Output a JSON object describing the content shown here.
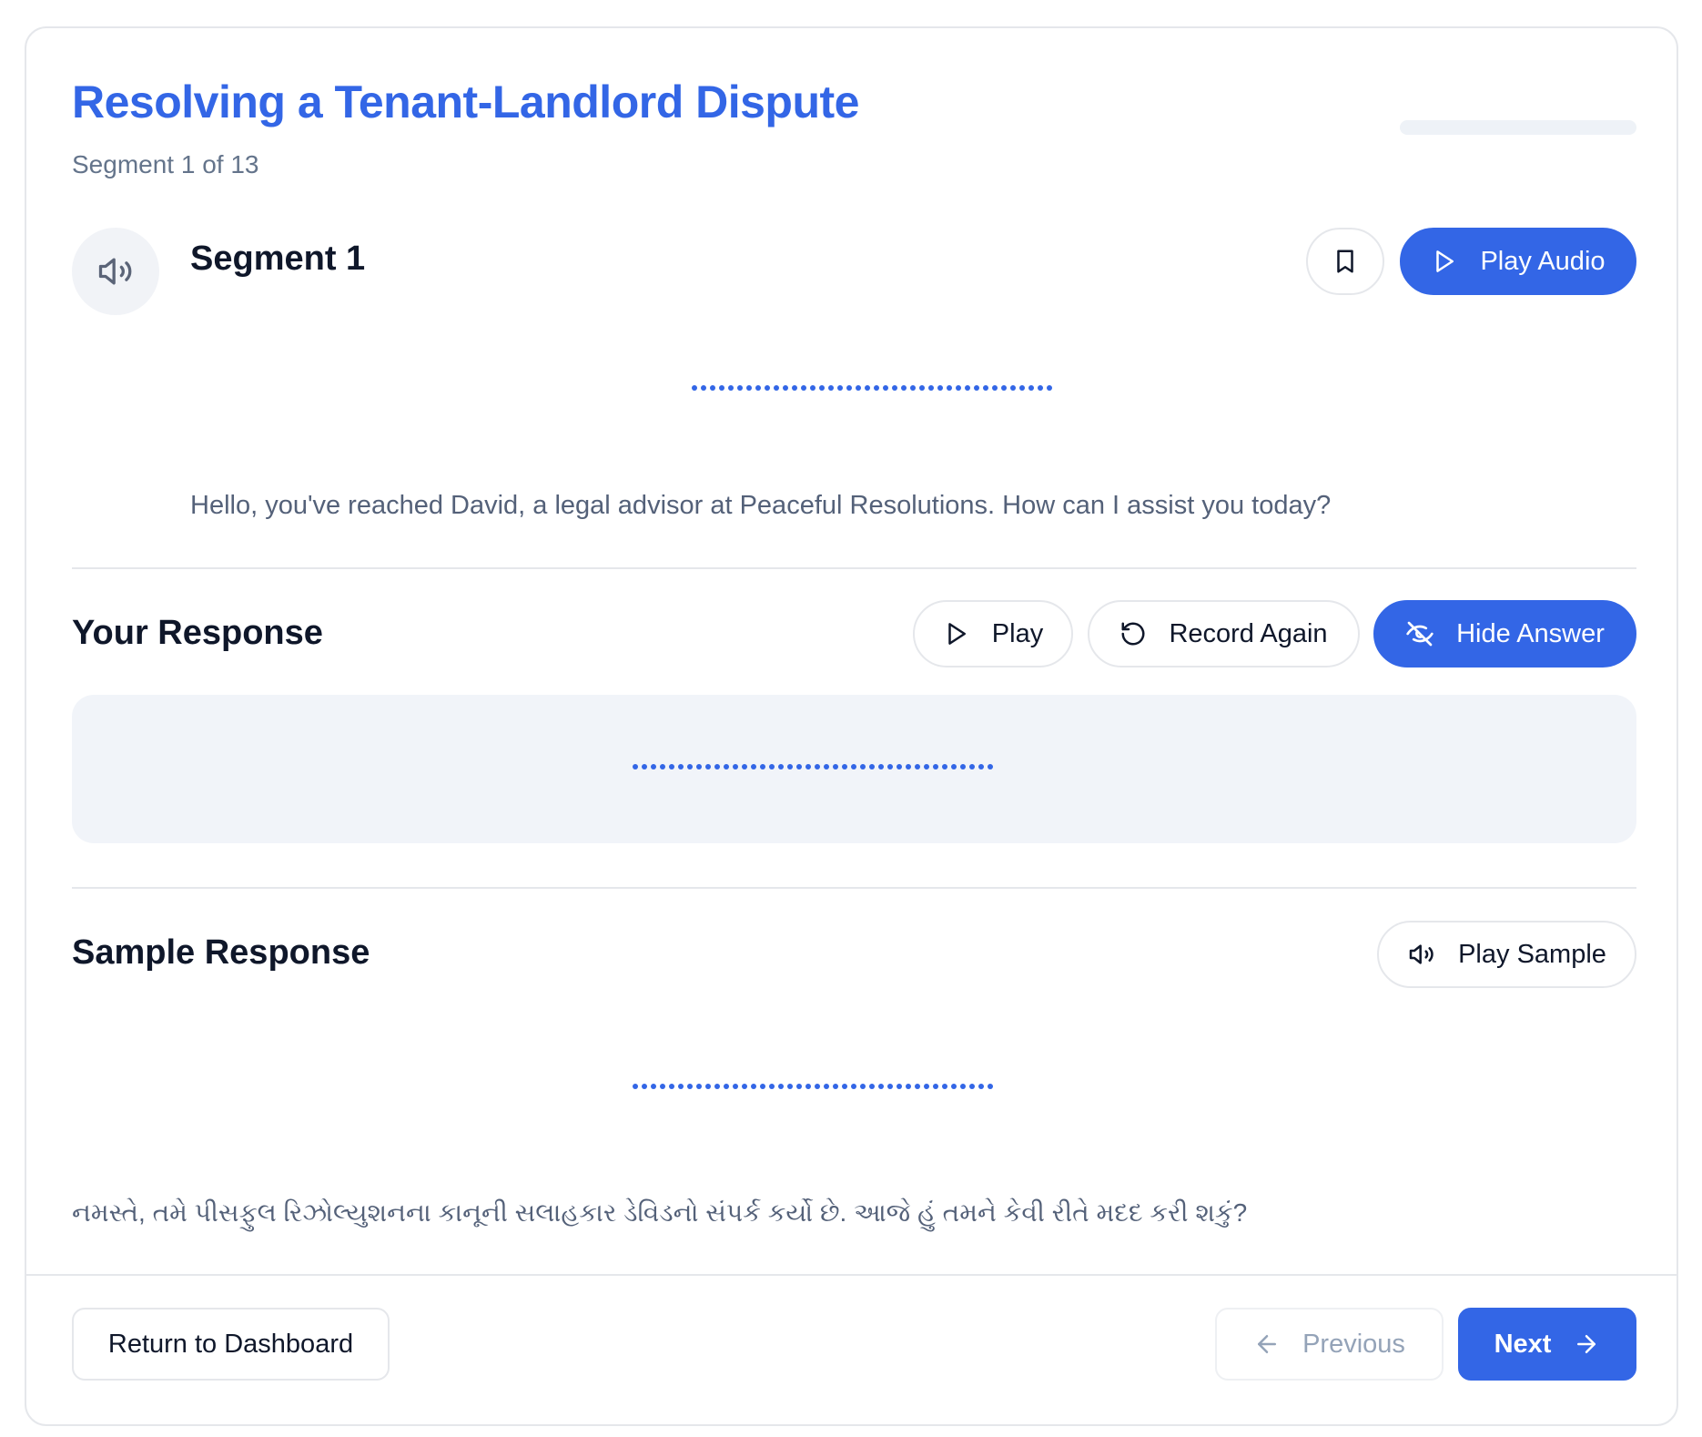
{
  "header": {
    "title": "Resolving a Tenant-Landlord Dispute",
    "subtitle": "Segment 1 of 13",
    "progress_fraction": 0.0
  },
  "segment": {
    "title": "Segment 1",
    "play_audio_label": "Play Audio",
    "english_text": "Hello, you've reached David, a legal advisor at Peaceful Resolutions. How can I assist you today?"
  },
  "response": {
    "heading": "Your Response",
    "play_label": "Play",
    "record_again_label": "Record Again",
    "hide_answer_label": "Hide Answer"
  },
  "sample": {
    "heading": "Sample Response",
    "play_sample_label": "Play Sample",
    "gujarati_text": "નમસ્તે, તમે પીસફુલ રિઝોલ્યુશનના કાનૂની સલાહકાર ડેવિડનો સંપર્ક કર્યો છે. આજે હું તમને કેવી રીતે મદદ કરી શકું?"
  },
  "footer": {
    "dashboard_label": "Return to Dashboard",
    "previous_label": "Previous",
    "next_label": "Next"
  },
  "icons": {
    "speaker": "speaker-icon",
    "bookmark": "bookmark-icon",
    "play": "play-icon",
    "rotate": "rotate-ccw-icon",
    "eye_off": "eye-off-icon",
    "arrow_left": "arrow-left-icon",
    "arrow_right": "arrow-right-icon"
  },
  "colors": {
    "accent": "#3366e6",
    "muted_text": "#546179",
    "box_bg": "#f1f4f9"
  }
}
